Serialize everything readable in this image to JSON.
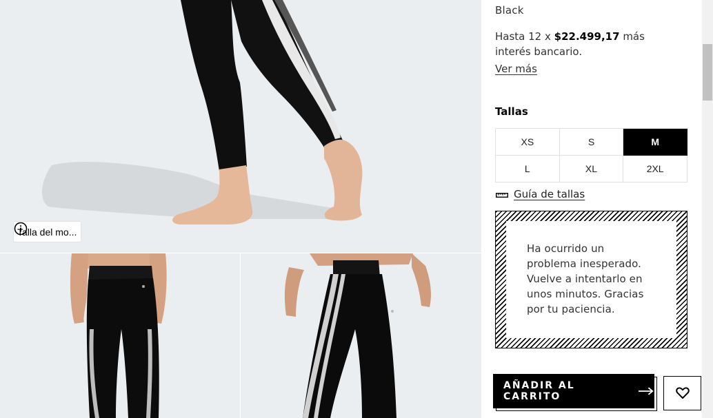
{
  "gallery": {
    "model_size_label": "Talla del mo...",
    "images": [
      {
        "name": "main-image",
        "icon": "tights-side-view"
      },
      {
        "name": "thumb-back",
        "icon": "tights-back-view"
      },
      {
        "name": "thumb-front",
        "icon": "tights-front-view"
      }
    ]
  },
  "product": {
    "color": "Black",
    "installments_prefix": "Hasta 12 x ",
    "installments_amount": "$22.499,17",
    "installments_suffix": " más interés bancario.",
    "see_more": "Ver más"
  },
  "sizes": {
    "title": "Tallas",
    "options": [
      "XS",
      "S",
      "M",
      "L",
      "XL",
      "2XL"
    ],
    "selected": "M",
    "guide_label": "Guía de tallas"
  },
  "error": {
    "message": "Ha ocurrido un problema inesperado. Vuelve a intentarlo en unos minutos. Gracias por tu paciencia."
  },
  "actions": {
    "add_to_cart": "AÑADIR AL CARRITO",
    "wishlist_icon": "heart-icon"
  },
  "colors": {
    "accent": "#000000",
    "gallery_bg": "#ebeef0",
    "text": "#333333"
  }
}
